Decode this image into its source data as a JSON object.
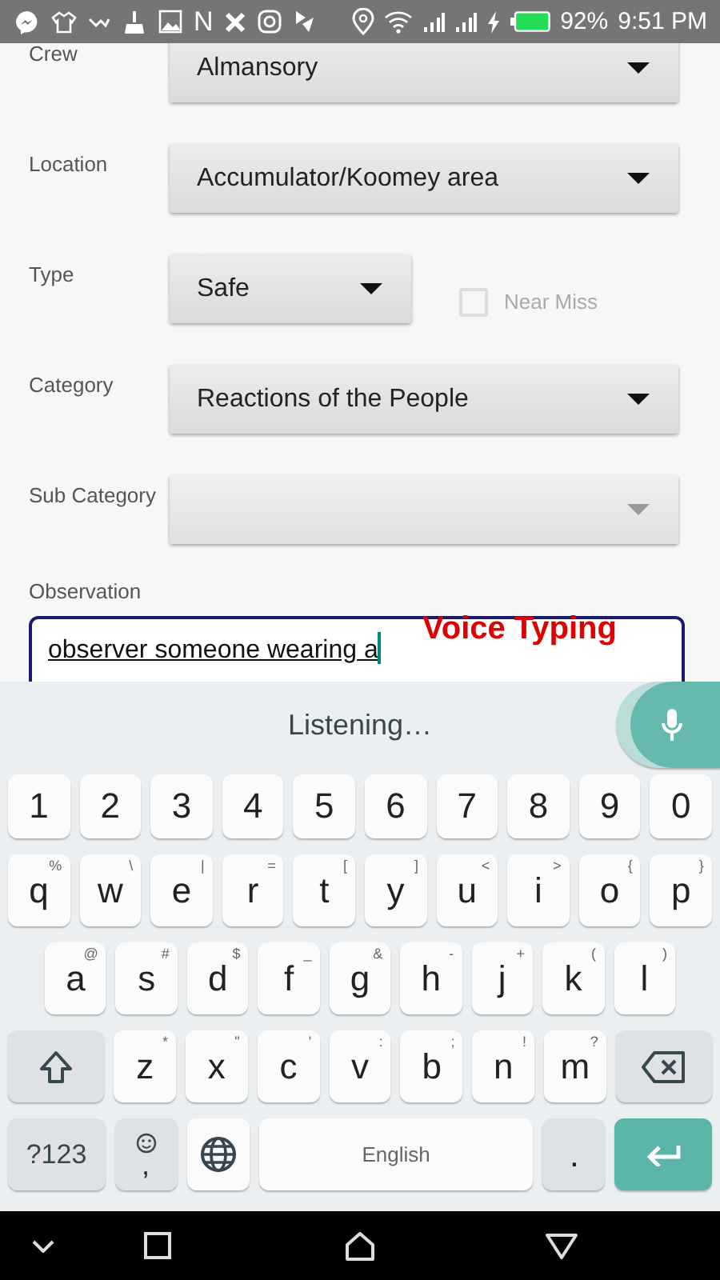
{
  "status_bar": {
    "glyph": "N",
    "battery": "92%",
    "time": "9:51 PM"
  },
  "form": {
    "fields": [
      {
        "label": "Crew",
        "kind": "dropdown",
        "value": "Almansory",
        "disabled": false
      },
      {
        "label": "Location",
        "kind": "dropdown",
        "value": "Accumulator/Koomey area",
        "disabled": false
      },
      {
        "label": "Type",
        "kind": "dropdown",
        "value": "Safe",
        "disabled": false,
        "checkbox": {
          "label": "Near Miss",
          "checked": false,
          "disabled": true
        }
      },
      {
        "label": "Category",
        "kind": "dropdown",
        "value": "Reactions of the People",
        "disabled": false
      },
      {
        "label": "Sub Category",
        "kind": "dropdown",
        "disabled": true
      },
      {
        "label": "Observation",
        "kind": "text",
        "value": "observer someone wearing a",
        "focused": true,
        "annotation": "Voice Typing"
      }
    ]
  },
  "keyboard": {
    "status": "Listening…",
    "rows": [
      {
        "keys": [
          {
            "kind": "char",
            "label": "1"
          },
          {
            "kind": "char",
            "label": "2"
          },
          {
            "kind": "char",
            "label": "3"
          },
          {
            "kind": "char",
            "label": "4"
          },
          {
            "kind": "char",
            "label": "5"
          },
          {
            "kind": "char",
            "label": "6"
          },
          {
            "kind": "char",
            "label": "7"
          },
          {
            "kind": "char",
            "label": "8"
          },
          {
            "kind": "char",
            "label": "9"
          },
          {
            "kind": "char",
            "label": "0"
          }
        ]
      },
      {
        "keys": [
          {
            "kind": "char",
            "label": "q",
            "hint": "%"
          },
          {
            "kind": "char",
            "label": "w",
            "hint": "\\"
          },
          {
            "kind": "char",
            "label": "e",
            "hint": "|"
          },
          {
            "kind": "char",
            "label": "r",
            "hint": "="
          },
          {
            "kind": "char",
            "label": "t",
            "hint": "["
          },
          {
            "kind": "char",
            "label": "y",
            "hint": "]"
          },
          {
            "kind": "char",
            "label": "u",
            "hint": "<"
          },
          {
            "kind": "char",
            "label": "i",
            "hint": ">"
          },
          {
            "kind": "char",
            "label": "o",
            "hint": "{"
          },
          {
            "kind": "char",
            "label": "p",
            "hint": "}"
          }
        ]
      },
      {
        "keys": [
          {
            "kind": "char",
            "label": "a",
            "hint": "@"
          },
          {
            "kind": "char",
            "label": "s",
            "hint": "#"
          },
          {
            "kind": "char",
            "label": "d",
            "hint": "$"
          },
          {
            "kind": "char",
            "label": "f",
            "hint": "_"
          },
          {
            "kind": "char",
            "label": "g",
            "hint": "&"
          },
          {
            "kind": "char",
            "label": "h",
            "hint": "-"
          },
          {
            "kind": "char",
            "label": "j",
            "hint": "+"
          },
          {
            "kind": "char",
            "label": "k",
            "hint": "("
          },
          {
            "kind": "char",
            "label": "l",
            "hint": ")"
          }
        ]
      },
      {
        "keys": [
          {
            "kind": "shift"
          },
          {
            "kind": "char",
            "label": "z",
            "hint": "*"
          },
          {
            "kind": "char",
            "label": "x",
            "hint": "\""
          },
          {
            "kind": "char",
            "label": "c",
            "hint": "'"
          },
          {
            "kind": "char",
            "label": "v",
            "hint": ":"
          },
          {
            "kind": "char",
            "label": "b",
            "hint": ";"
          },
          {
            "kind": "char",
            "label": "n",
            "hint": "!"
          },
          {
            "kind": "char",
            "label": "m",
            "hint": "?"
          },
          {
            "kind": "backspace"
          }
        ]
      },
      {
        "keys": [
          {
            "kind": "mode",
            "label": "?123"
          },
          {
            "kind": "emoji",
            "label": ","
          },
          {
            "kind": "globe"
          },
          {
            "kind": "space",
            "label": "English"
          },
          {
            "kind": "punct",
            "label": "."
          },
          {
            "kind": "enter"
          }
        ]
      }
    ]
  }
}
